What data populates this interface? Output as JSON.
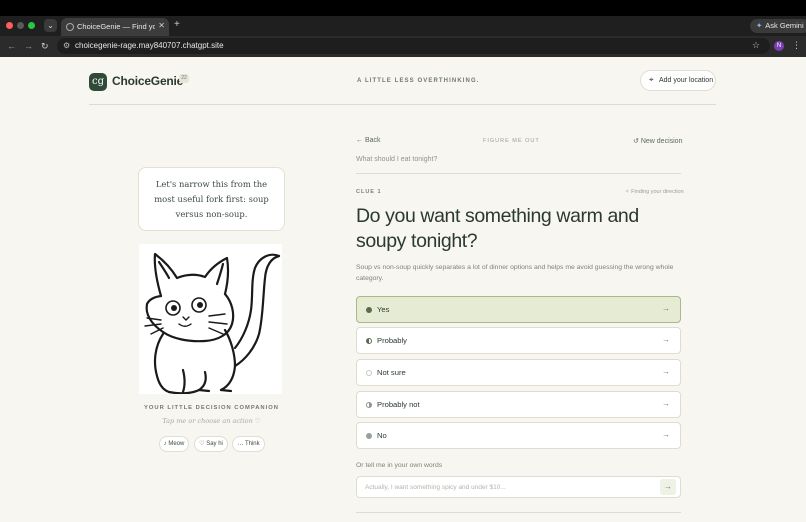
{
  "browser": {
    "tab_title": "ChoiceGenie — Find your cl...",
    "new_tab": "+",
    "url": "choicegenie-rage.may840707.chatgpt.site",
    "ask_gemini": "Ask Gemini",
    "profile_initial": "N"
  },
  "header": {
    "logo_glyph": "cg",
    "brand": "ChoiceGenie",
    "brand_badge": "22",
    "tagline": "A LITTLE LESS OVERTHINKING.",
    "location_button": "Add your location"
  },
  "companion": {
    "bubble": "Let's narrow this from the most useful fork first: soup versus non-soup.",
    "title": "YOUR LITTLE DECISION COMPANION",
    "hint": "Tap me or choose an action ♡",
    "actions": [
      {
        "icon": "♪",
        "label": "Meow"
      },
      {
        "icon": "♡",
        "label": "Say hi"
      },
      {
        "icon": "…",
        "label": "Think"
      }
    ]
  },
  "decision": {
    "back": "Back",
    "section": "FIGURE ME OUT",
    "new_decision": "New decision",
    "question_source": "What should I eat tonight?",
    "clue": "CLUE 1",
    "status": "Finding your direction",
    "question": "Do you want something warm and soupy tonight?",
    "explanation": "Soup vs non-soup quickly separates a lot of dinner options and helps me avoid guessing the wrong whole category.",
    "options": [
      {
        "label": "Yes",
        "selected": true
      },
      {
        "label": "Probably",
        "selected": false
      },
      {
        "label": "Not sure",
        "selected": false
      },
      {
        "label": "Probably not",
        "selected": false
      },
      {
        "label": "No",
        "selected": false
      }
    ],
    "own_words_label": "Or tell me in your own words",
    "own_words_placeholder": "Actually, I want something spicy and under $10..."
  },
  "colors": {
    "accent_dark": "#2f4a36",
    "selected_bg": "#e5ecd3",
    "page_bg": "#f7f6f0"
  }
}
